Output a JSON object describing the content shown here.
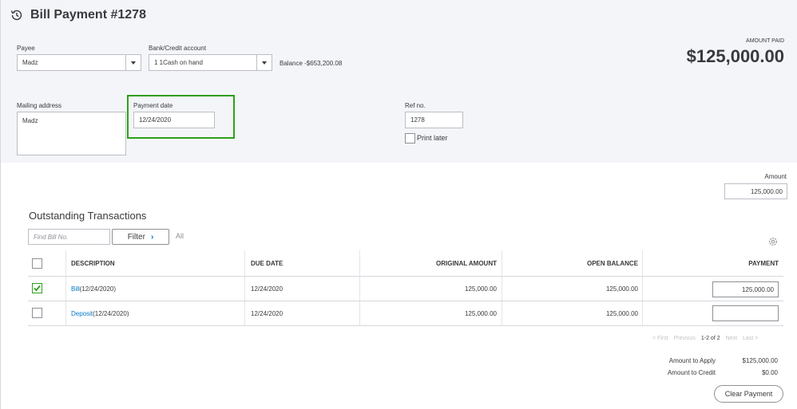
{
  "header": {
    "title": "Bill Payment #1278",
    "amount_paid_label": "AMOUNT PAID",
    "amount_paid_value": "$125,000.00"
  },
  "form": {
    "payee_label": "Payee",
    "payee_value": "Madz",
    "bank_label": "Bank/Credit account",
    "bank_value": "1 1Cash on hand",
    "balance_text": "Balance -$653,200.08",
    "mailing_label": "Mailing address",
    "mailing_value": "Madz",
    "payment_date_label": "Payment date",
    "payment_date_value": "12/24/2020",
    "ref_label": "Ref no.",
    "ref_value": "1278",
    "print_later_label": "Print later",
    "print_later_checked": false
  },
  "amount": {
    "label": "Amount",
    "value": "125,000.00"
  },
  "transactions": {
    "title": "Outstanding Transactions",
    "find_placeholder": "Find Bill No.",
    "filter_label": "Filter",
    "filter_state": "All",
    "columns": [
      "DESCRIPTION",
      "DUE DATE",
      "ORIGINAL AMOUNT",
      "OPEN BALANCE",
      "PAYMENT"
    ],
    "rows": [
      {
        "checked": true,
        "link": "Bill",
        "desc": " (12/24/2020)",
        "due": "12/24/2020",
        "original": "125,000.00",
        "open": "125,000.00",
        "payment": "125,000.00"
      },
      {
        "checked": false,
        "link": "Deposit",
        "desc": " (12/24/2020)",
        "due": "12/24/2020",
        "original": "125,000.00",
        "open": "125,000.00",
        "payment": ""
      }
    ]
  },
  "pager": {
    "first": "< First",
    "previous": "Previous",
    "range": "1-2 of 2",
    "next": "Next",
    "last": "Last >"
  },
  "summary": {
    "apply_label": "Amount to Apply",
    "apply_value": "$125,000.00",
    "credit_label": "Amount to Credit",
    "credit_value": "$0.00",
    "clear_label": "Clear Payment"
  },
  "colors": {
    "accent_green": "#2ca01c",
    "link_blue": "#0077c5",
    "panel_bg": "#f4f5f8"
  }
}
